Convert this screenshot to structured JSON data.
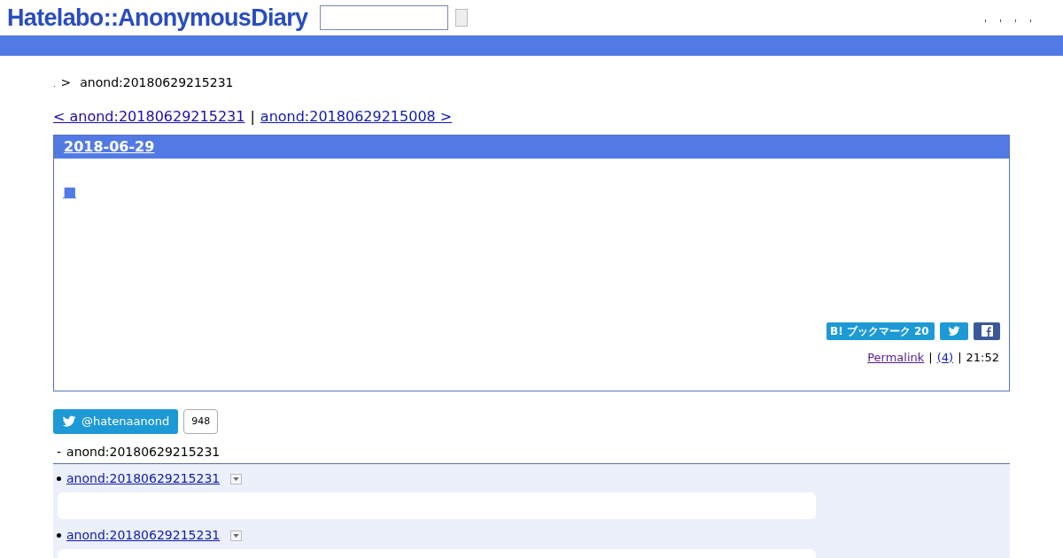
{
  "header": {
    "logo": "Hatelabo::AnonymousDiary"
  },
  "breadcrumb": {
    "dot": ".",
    "separator": ">",
    "current": "anond:20180629215231"
  },
  "pager": {
    "prev": "< anond:20180629215231",
    "divider": "|",
    "next": "anond:20180629215008 >"
  },
  "entry": {
    "date": "2018-06-29",
    "title": "■",
    "bookmark": "B! ブックマーク 20",
    "footer": {
      "permalink": "Permalink",
      "sep1": "|",
      "comments": "(4)",
      "sep2": "|",
      "time": "21:52"
    }
  },
  "twitter": {
    "handle": "@hatenaanond",
    "count": "948"
  },
  "references": {
    "marker": "-",
    "title": "anond:20180629215231",
    "items": [
      {
        "link": "anond:20180629215231"
      },
      {
        "link": "anond:20180629215231"
      }
    ]
  }
}
